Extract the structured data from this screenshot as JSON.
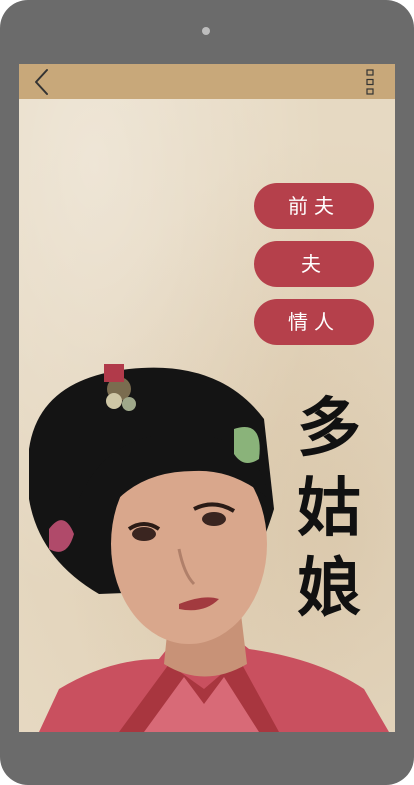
{
  "tags": [
    {
      "label": "前夫"
    },
    {
      "label": "夫"
    },
    {
      "label": "情人"
    }
  ],
  "title": {
    "chars": [
      "多",
      "姑",
      "娘"
    ]
  },
  "colors": {
    "tag_bg": "#b5404b",
    "top_bar": "#c8a87a",
    "paper": "#e6d9c2",
    "device_frame": "#6b6b6b"
  },
  "icons": {
    "back": "chevron-left-icon",
    "menu": "vertical-dots-icon"
  }
}
